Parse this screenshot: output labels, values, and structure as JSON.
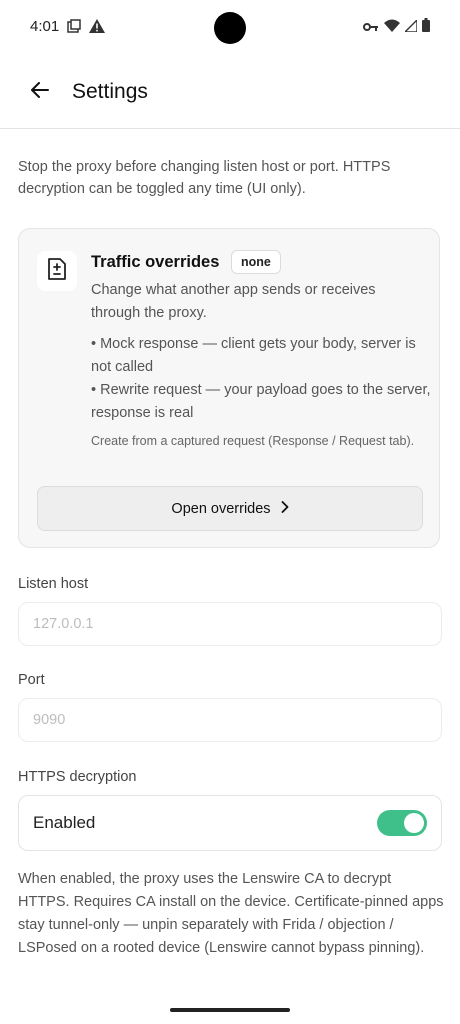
{
  "status_bar": {
    "time": "4:01",
    "left_icons": [
      "screenshot-icon",
      "warning-icon"
    ],
    "right_icons": [
      "vpn-key-icon",
      "wifi-icon",
      "cell-signal-icon",
      "battery-icon"
    ]
  },
  "header": {
    "title": "Settings",
    "back_icon": "arrow-left-icon"
  },
  "intro_text": "Stop the proxy before changing listen host or port. HTTPS decryption can be toggled any time (UI only).",
  "overrides_card": {
    "icon": "diff-document-icon",
    "title": "Traffic overrides",
    "badge": "none",
    "description": "Change what another app sends or receives through the proxy.",
    "bullets": [
      "• Mock response — client gets your body, server is not called",
      "• Rewrite request — your payload goes to the server, response is real"
    ],
    "note": "Create from a captured request (Response / Request tab).",
    "button_label": "Open overrides",
    "button_icon": "chevron-right-icon"
  },
  "listen_host": {
    "label": "Listen host",
    "placeholder": "127.0.0.1"
  },
  "port": {
    "label": "Port",
    "placeholder": "9090"
  },
  "https_decryption": {
    "label": "HTTPS decryption",
    "toggle_label": "Enabled",
    "enabled": true,
    "accent_color": "#3fbf8a"
  },
  "help_text": "When enabled, the proxy uses the Lenswire CA to decrypt HTTPS. Requires CA install on the device. Certificate-pinned apps stay tunnel-only — unpin separately with Frida / objection / LSPosed on a rooted device (Lenswire cannot bypass pinning)."
}
